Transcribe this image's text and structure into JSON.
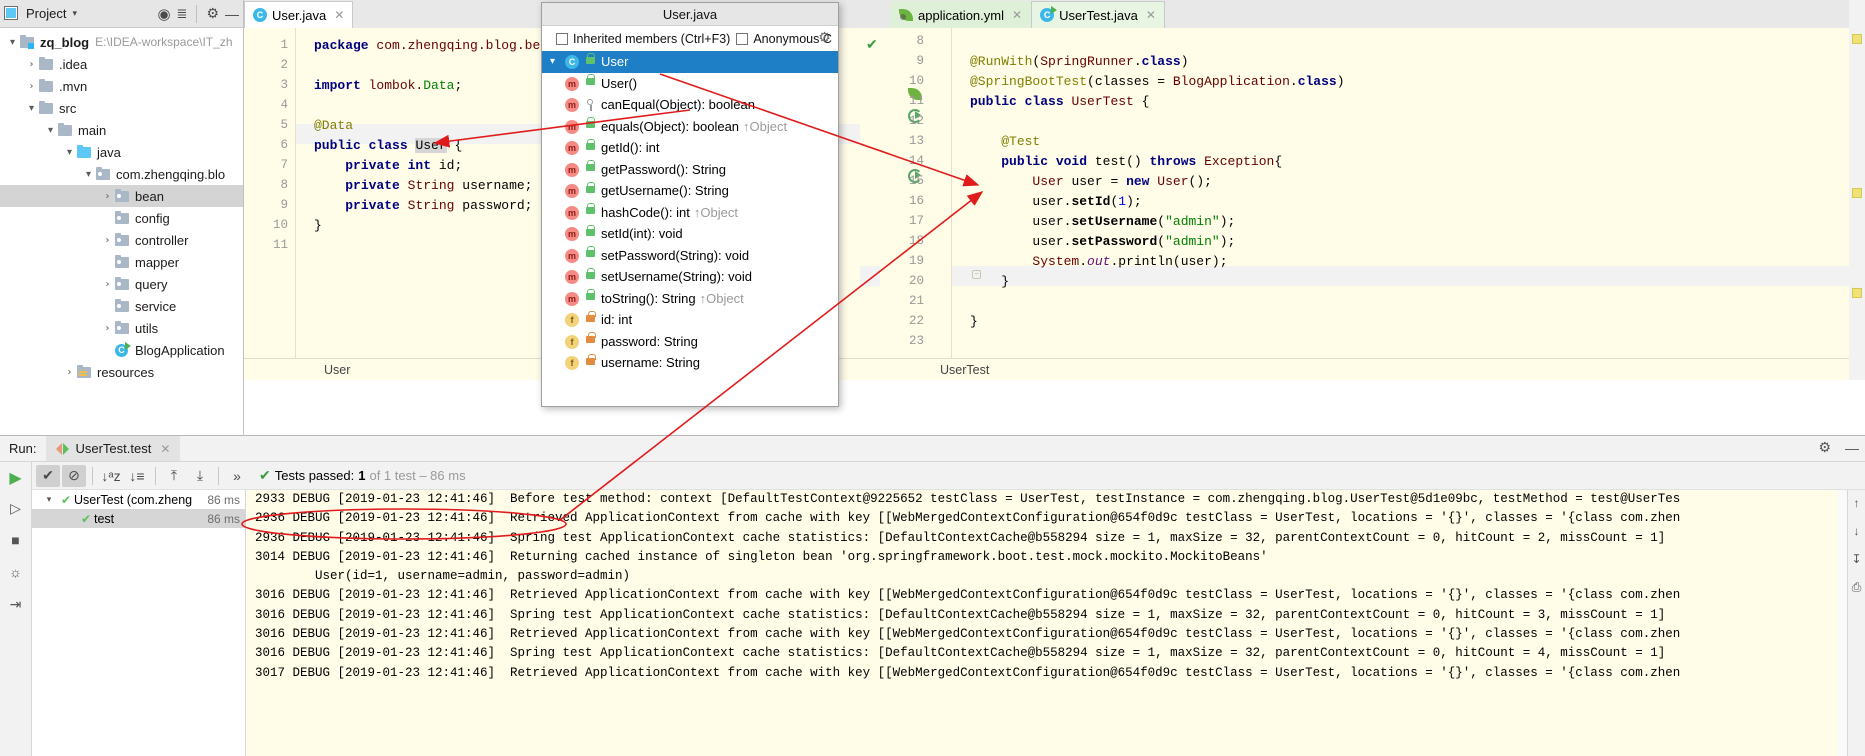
{
  "project_panel": {
    "header": {
      "title": "Project",
      "caret": "▾",
      "icons": [
        "locate-icon",
        "collapse-all-icon",
        "settings-icon",
        "hide-icon"
      ]
    },
    "tree": [
      {
        "depth": 0,
        "arrow": "▾",
        "icon": "module-folder",
        "label": "zq_blog",
        "bold": true,
        "path": "E:\\IDEA-workspace\\IT_zh",
        "selected": false
      },
      {
        "depth": 1,
        "arrow": "›",
        "icon": "folder",
        "label": ".idea",
        "bold": false,
        "path": "",
        "selected": false
      },
      {
        "depth": 1,
        "arrow": "›",
        "icon": "folder",
        "label": ".mvn",
        "bold": false,
        "path": "",
        "selected": false
      },
      {
        "depth": 1,
        "arrow": "▾",
        "icon": "folder",
        "label": "src",
        "bold": false,
        "path": "",
        "selected": false
      },
      {
        "depth": 2,
        "arrow": "▾",
        "icon": "folder",
        "label": "main",
        "bold": false,
        "path": "",
        "selected": false
      },
      {
        "depth": 3,
        "arrow": "▾",
        "icon": "source-folder",
        "label": "java",
        "bold": false,
        "path": "",
        "selected": false
      },
      {
        "depth": 4,
        "arrow": "▾",
        "icon": "package",
        "label": "com.zhengqing.blo",
        "bold": false,
        "path": "",
        "selected": false
      },
      {
        "depth": 5,
        "arrow": "›",
        "icon": "package",
        "label": "bean",
        "bold": false,
        "path": "",
        "selected": true
      },
      {
        "depth": 5,
        "arrow": "",
        "icon": "package",
        "label": "config",
        "bold": false,
        "path": "",
        "selected": false
      },
      {
        "depth": 5,
        "arrow": "›",
        "icon": "package",
        "label": "controller",
        "bold": false,
        "path": "",
        "selected": false
      },
      {
        "depth": 5,
        "arrow": "",
        "icon": "package",
        "label": "mapper",
        "bold": false,
        "path": "",
        "selected": false
      },
      {
        "depth": 5,
        "arrow": "›",
        "icon": "package",
        "label": "query",
        "bold": false,
        "path": "",
        "selected": false
      },
      {
        "depth": 5,
        "arrow": "",
        "icon": "package",
        "label": "service",
        "bold": false,
        "path": "",
        "selected": false
      },
      {
        "depth": 5,
        "arrow": "›",
        "icon": "package",
        "label": "utils",
        "bold": false,
        "path": "",
        "selected": false
      },
      {
        "depth": 5,
        "arrow": "",
        "icon": "java-class-runnable",
        "label": "BlogApplication",
        "bold": false,
        "path": "",
        "selected": false
      },
      {
        "depth": 3,
        "arrow": "›",
        "icon": "resources-folder",
        "label": "resources",
        "bold": false,
        "path": "",
        "selected": false
      }
    ]
  },
  "editor_left": {
    "tab": {
      "label": "User.java",
      "icon": "java-class-icon",
      "close": "✕"
    },
    "breadcrumb": "User",
    "lines": [
      {
        "n": "1",
        "html": "<span class='kw'>package</span> <span class='pkgname'>com.zhengqing.blog.bean;</span>"
      },
      {
        "n": "2",
        "html": ""
      },
      {
        "n": "3",
        "html": "<span class='kw'>import</span> <span class='pkgname'>lombok.</span><span class='str'>Data</span><span class='plain'>;</span>"
      },
      {
        "n": "4",
        "html": ""
      },
      {
        "n": "5",
        "html": "<span class='ann'>@Data</span>"
      },
      {
        "n": "6",
        "html": "<span class='kw'>public class</span> <span class='sel-txt'>User</span> {"
      },
      {
        "n": "7",
        "html": "    <span class='kw'>private int</span> <span class='plain'>id;</span>"
      },
      {
        "n": "8",
        "html": "    <span class='kw'>private</span> <span class='typ'>String</span> <span class='plain'>username;</span>"
      },
      {
        "n": "9",
        "html": "    <span class='kw'>private</span> <span class='typ'>String</span> <span class='plain'>password;</span>"
      },
      {
        "n": "10",
        "html": "}"
      },
      {
        "n": "11",
        "html": ""
      }
    ],
    "highlighted_line": 6
  },
  "structure_popup": {
    "title": "User.java",
    "options": [
      {
        "label": "Inherited members (Ctrl+F3)",
        "checked": false
      },
      {
        "label": "Anonymous C",
        "checked": false
      }
    ],
    "gear_icon": "settings-gear-icon",
    "items": [
      {
        "depth": 0,
        "caret": "▾",
        "kind": "c",
        "vis": "public",
        "label": "User",
        "override": "",
        "selected": true
      },
      {
        "depth": 1,
        "caret": "",
        "kind": "m",
        "vis": "public",
        "label": "User()",
        "override": "",
        "selected": false
      },
      {
        "depth": 1,
        "caret": "",
        "kind": "m",
        "vis": "protected",
        "label": "canEqual(Object): boolean",
        "override": "",
        "selected": false
      },
      {
        "depth": 1,
        "caret": "",
        "kind": "m",
        "vis": "public",
        "label": "equals(Object): boolean",
        "override": "↑Object",
        "selected": false
      },
      {
        "depth": 1,
        "caret": "",
        "kind": "m",
        "vis": "public",
        "label": "getId(): int",
        "override": "",
        "selected": false
      },
      {
        "depth": 1,
        "caret": "",
        "kind": "m",
        "vis": "public",
        "label": "getPassword(): String",
        "override": "",
        "selected": false
      },
      {
        "depth": 1,
        "caret": "",
        "kind": "m",
        "vis": "public",
        "label": "getUsername(): String",
        "override": "",
        "selected": false
      },
      {
        "depth": 1,
        "caret": "",
        "kind": "m",
        "vis": "public",
        "label": "hashCode(): int",
        "override": "↑Object",
        "selected": false
      },
      {
        "depth": 1,
        "caret": "",
        "kind": "m",
        "vis": "public",
        "label": "setId(int): void",
        "override": "",
        "selected": false
      },
      {
        "depth": 1,
        "caret": "",
        "kind": "m",
        "vis": "public",
        "label": "setPassword(String): void",
        "override": "",
        "selected": false
      },
      {
        "depth": 1,
        "caret": "",
        "kind": "m",
        "vis": "public",
        "label": "setUsername(String): void",
        "override": "",
        "selected": false
      },
      {
        "depth": 1,
        "caret": "",
        "kind": "m",
        "vis": "public",
        "label": "toString(): String",
        "override": "↑Object",
        "selected": false
      },
      {
        "depth": 1,
        "caret": "",
        "kind": "f",
        "vis": "private",
        "label": "id: int",
        "override": "",
        "selected": false
      },
      {
        "depth": 1,
        "caret": "",
        "kind": "f",
        "vis": "private",
        "label": "password: String",
        "override": "",
        "selected": false
      },
      {
        "depth": 1,
        "caret": "",
        "kind": "f",
        "vis": "private",
        "label": "username: String",
        "override": "",
        "selected": false
      }
    ]
  },
  "editor_right": {
    "tabs": [
      {
        "label": "application.yml",
        "icon": "spring-leaf-icon",
        "active": false,
        "close": "✕"
      },
      {
        "label": "UserTest.java",
        "icon": "java-test-class-icon",
        "active": true,
        "close": "✕"
      }
    ],
    "breadcrumb": "UserTest",
    "inspection_status": "✔",
    "lines": [
      {
        "n": "8",
        "html": ""
      },
      {
        "n": "9",
        "html": "<span class='ann'>@RunWith</span>(<span class='typ'>SpringRunner</span>.<span class='kw'>class</span>)"
      },
      {
        "n": "10",
        "html": "<span class='ann'>@SpringBootTest</span>(<span class='plain'>classes = </span><span class='typ'>BlogApplication</span>.<span class='kw'>class</span>)"
      },
      {
        "n": "11",
        "html": "<span class='kw'>public class</span> <span class='typ'>UserTest</span> {"
      },
      {
        "n": "12",
        "html": ""
      },
      {
        "n": "13",
        "html": "    <span class='ann'>@Test</span>"
      },
      {
        "n": "14",
        "html": "    <span class='kw'>public void</span> <span class='plain'>test</span>() <span class='kw'>throws</span> <span class='typ'>Exception</span>{"
      },
      {
        "n": "15",
        "html": "        <span class='typ'>User</span> <span class='ident'>user</span> = <span class='kw'>new</span> <span class='typ'>User</span>();"
      },
      {
        "n": "16",
        "html": "        <span class='ident'>user</span>.<span class='plain'><b>setId</b></span>(<span class='num'>1</span>);"
      },
      {
        "n": "17",
        "html": "        <span class='ident'>user</span>.<span class='plain'><b>setUsername</b></span>(<span class='str'>\"admin\"</span>);"
      },
      {
        "n": "18",
        "html": "        <span class='ident'>user</span>.<span class='plain'><b>setPassword</b></span>(<span class='str'>\"admin\"</span>);"
      },
      {
        "n": "19",
        "html": "        <span class='typ'>System</span>.<span class='fld'>out</span>.<span class='plain'>println</span>(<span class='ident'>user</span>);"
      },
      {
        "n": "20",
        "html": "    }"
      },
      {
        "n": "21",
        "html": ""
      },
      {
        "n": "22",
        "html": "}"
      },
      {
        "n": "23",
        "html": ""
      }
    ],
    "highlighted_line": 20
  },
  "run_panel": {
    "label": "Run:",
    "tab": {
      "label": "UserTest.test",
      "icon": "run-config-icon",
      "close": "✕"
    },
    "header_icons": [
      "settings-gear-icon",
      "hide-panel-icon"
    ],
    "left_rail_icons": [
      "run-icon",
      "rerun-failed-icon",
      "stop-icon",
      "camera-icon",
      "export-icon"
    ],
    "toolbar": {
      "buttons": [
        {
          "name": "show-passed-toggle",
          "glyph": "✔",
          "active": true
        },
        {
          "name": "hide-ignored-toggle",
          "glyph": "⊘",
          "active": true
        },
        {
          "name": "sort-alphabetically",
          "glyph": "↓ᵃz",
          "active": false
        },
        {
          "name": "sort-by-duration",
          "glyph": "↓≡",
          "active": false
        },
        {
          "name": "expand-all",
          "glyph": "⤒",
          "active": false
        },
        {
          "name": "collapse-all",
          "glyph": "⤓",
          "active": false
        },
        {
          "name": "more-options",
          "glyph": "»",
          "active": false
        }
      ],
      "status_prefix": "Tests passed: ",
      "status_count": "1",
      "status_suffix": " of 1 test – 86 ms"
    },
    "test_tree": [
      {
        "depth": 0,
        "arrow": "▾",
        "name": "UserTest (com.zheng",
        "ms": "86 ms",
        "selected": false
      },
      {
        "depth": 1,
        "arrow": "",
        "name": "test",
        "ms": "86 ms",
        "selected": true
      }
    ],
    "console_lines": [
      "2933 DEBUG [2019-01-23 12:41:46]  Before test method: context [DefaultTestContext@9225652 testClass = UserTest, testInstance = com.zhengqing.blog.UserTest@5d1e09bc, testMethod = test@UserTes",
      "2936 DEBUG [2019-01-23 12:41:46]  Retrieved ApplicationContext from cache with key [[WebMergedContextConfiguration@654f0d9c testClass = UserTest, locations = '{}', classes = '{class com.zhen",
      "2936 DEBUG [2019-01-23 12:41:46]  Spring test ApplicationContext cache statistics: [DefaultContextCache@b558294 size = 1, maxSize = 32, parentContextCount = 0, hitCount = 2, missCount = 1]",
      "3014 DEBUG [2019-01-23 12:41:46]  Returning cached instance of singleton bean 'org.springframework.boot.test.mock.mockito.MockitoBeans'",
      "        User(id=1, username=admin, password=admin)",
      "3016 DEBUG [2019-01-23 12:41:46]  Retrieved ApplicationContext from cache with key [[WebMergedContextConfiguration@654f0d9c testClass = UserTest, locations = '{}', classes = '{class com.zhen",
      "3016 DEBUG [2019-01-23 12:41:46]  Spring test ApplicationContext cache statistics: [DefaultContextCache@b558294 size = 1, maxSize = 32, parentContextCount = 0, hitCount = 3, missCount = 1]",
      "3016 DEBUG [2019-01-23 12:41:46]  Retrieved ApplicationContext from cache with key [[WebMergedContextConfiguration@654f0d9c testClass = UserTest, locations = '{}', classes = '{class com.zhen",
      "3016 DEBUG [2019-01-23 12:41:46]  Spring test ApplicationContext cache statistics: [DefaultContextCache@b558294 size = 1, maxSize = 32, parentContextCount = 0, hitCount = 4, missCount = 1]",
      "3017 DEBUG [2019-01-23 12:41:46]  Retrieved ApplicationContext from cache with key [[WebMergedContextConfiguration@654f0d9c testClass = UserTest, locations = '{}', classes = '{class com.zhen"
    ],
    "console_rail_icons": [
      "scroll-up-icon",
      "scroll-down-icon",
      "wrap-icon",
      "print-icon"
    ]
  },
  "annotations": {
    "color": "#e01b1b",
    "ellipse_label": "User(id=1, username=admin, password=admin)",
    "arrow_count": 3
  }
}
